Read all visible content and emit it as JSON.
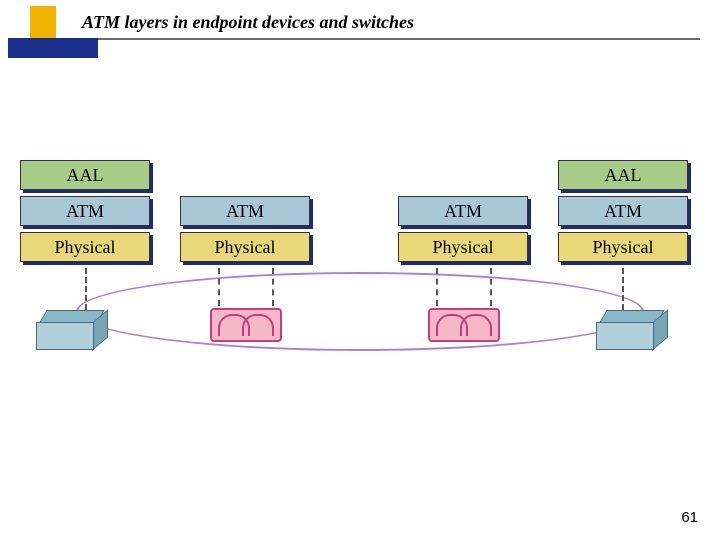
{
  "title": "ATM layers in endpoint devices and switches",
  "page_number": "61",
  "layers": {
    "aal": "AAL",
    "atm": "ATM",
    "physical": "Physical"
  },
  "columns": [
    {
      "role": "endpoint",
      "layers": [
        "aal",
        "atm",
        "physical"
      ]
    },
    {
      "role": "switch",
      "layers": [
        "atm",
        "physical"
      ]
    },
    {
      "role": "switch",
      "layers": [
        "atm",
        "physical"
      ]
    },
    {
      "role": "endpoint",
      "layers": [
        "aal",
        "atm",
        "physical"
      ]
    }
  ]
}
